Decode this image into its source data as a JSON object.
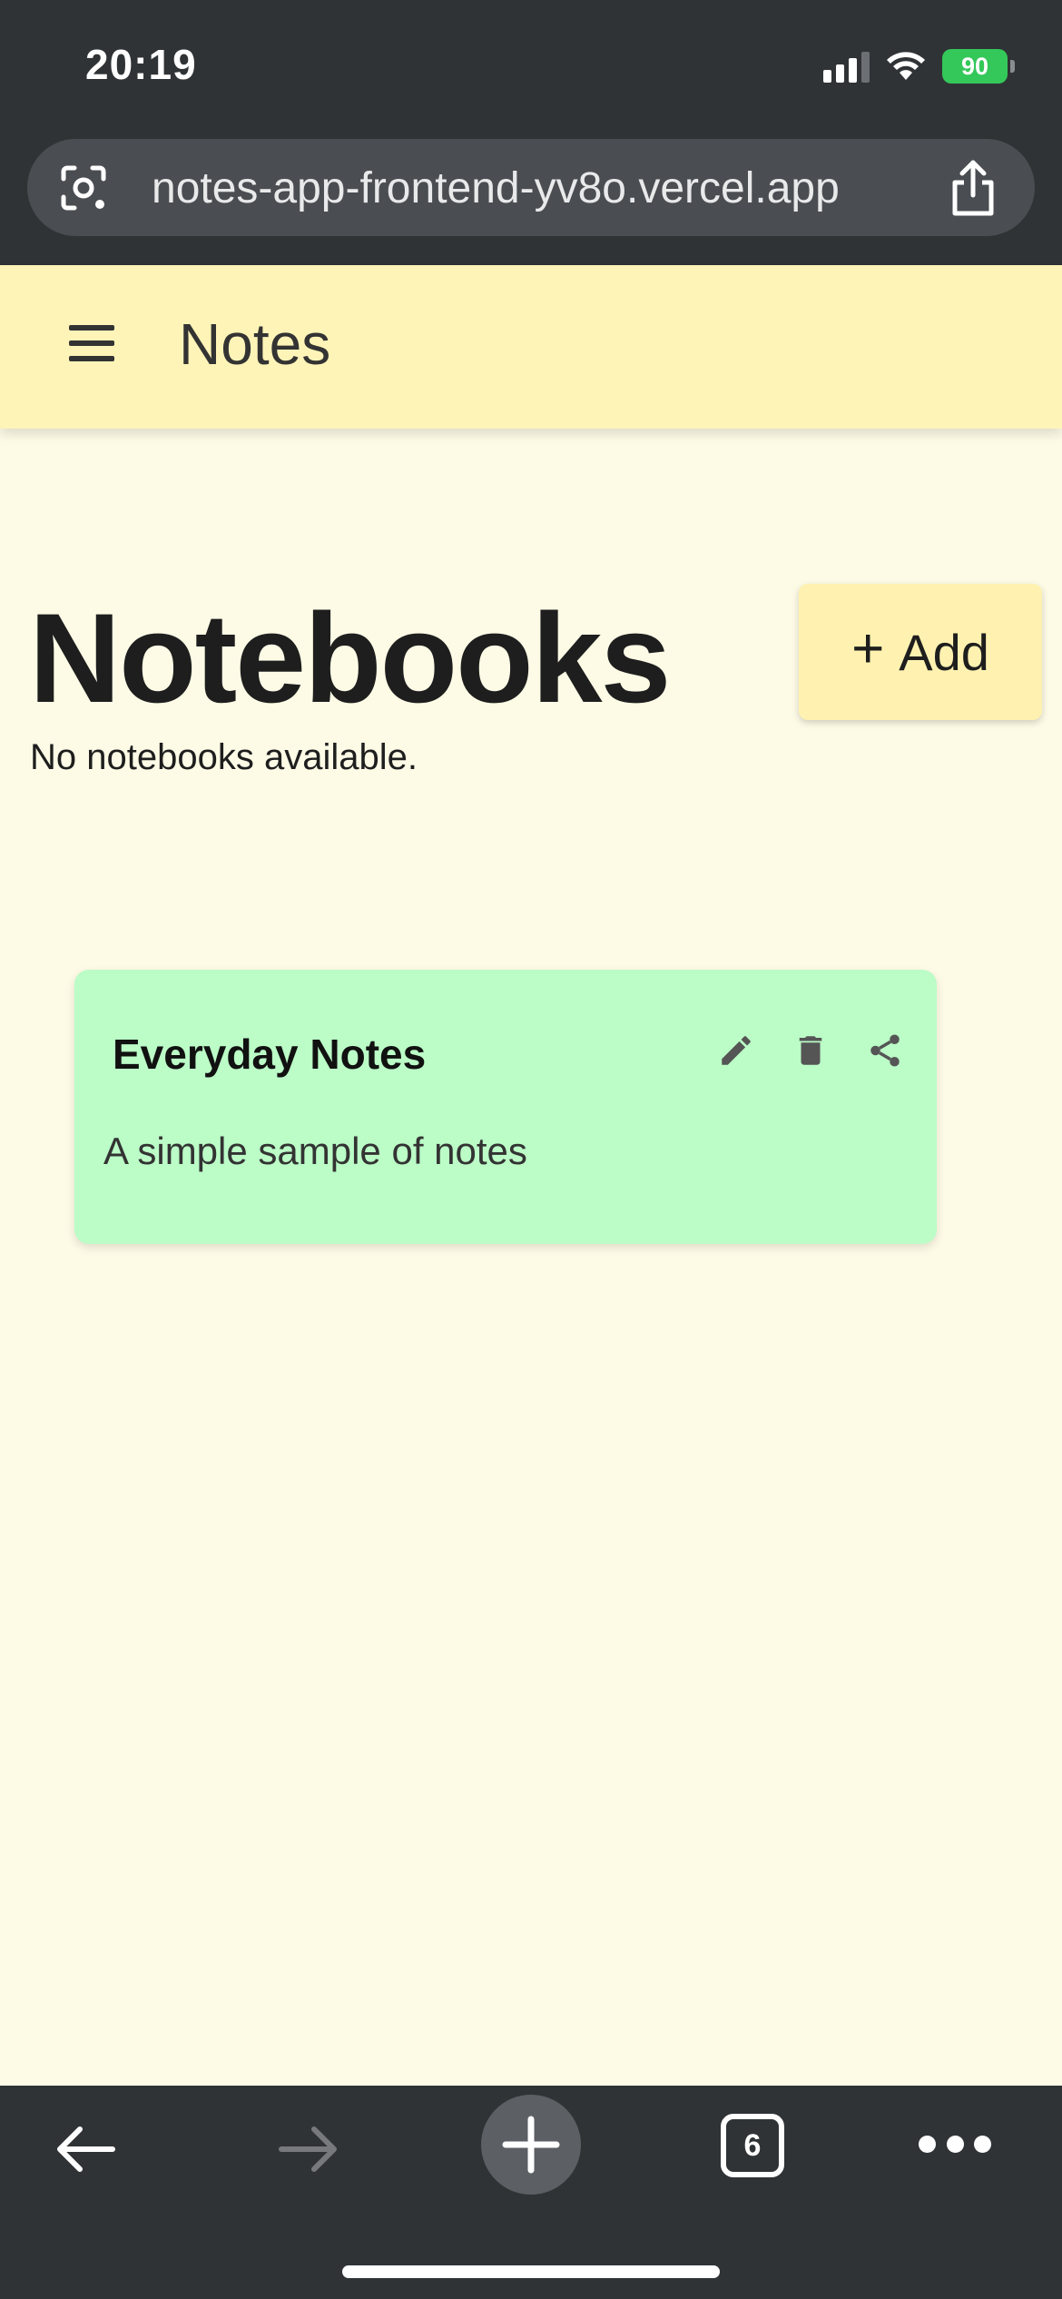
{
  "status_bar": {
    "time": "20:19",
    "battery_percent": "90",
    "icons": [
      "cellular-signal-icon",
      "wifi-icon",
      "battery-charging-icon"
    ]
  },
  "browser": {
    "url": "notes-app-frontend-yv8o.vercel.app",
    "open_tabs_count": "6",
    "icons": [
      "lens-icon",
      "share-icon",
      "back-arrow-icon",
      "forward-arrow-icon",
      "new-tab-plus-icon",
      "tabs-icon",
      "more-dots-icon"
    ]
  },
  "header": {
    "title": "Notes",
    "menu_icon": "hamburger-menu-icon"
  },
  "main": {
    "title": "Notebooks",
    "empty_message": "No notebooks available.",
    "add_button": {
      "icon": "plus-icon",
      "label": "Add"
    }
  },
  "notebooks": [
    {
      "title": "Everyday Notes",
      "description": "A simple sample of notes",
      "color": "#bbfcc7",
      "actions": [
        "edit-pencil-icon",
        "delete-trash-icon",
        "share-icon"
      ]
    }
  ],
  "colors": {
    "header_bg": "#fff4b8",
    "page_bg": "#fdfbe6",
    "add_button_bg": "#fff2b0",
    "browser_chrome": "#303336",
    "battery": "#34c759"
  }
}
